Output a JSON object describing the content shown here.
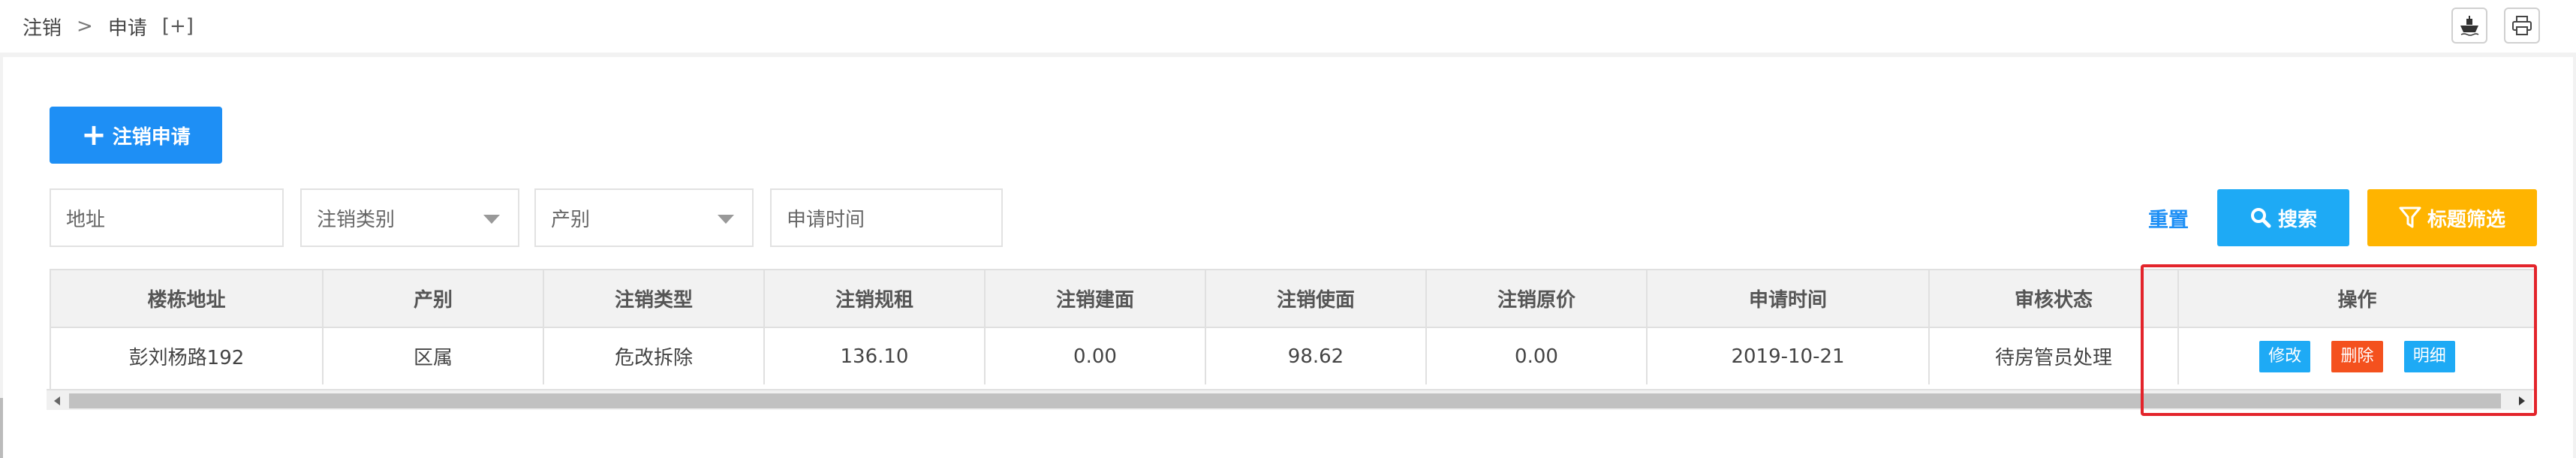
{
  "breadcrumb": {
    "root": "注销",
    "separator": ">",
    "current": "申请",
    "extra": "[+]"
  },
  "toolbar": {
    "icons": [
      "ship-icon",
      "print-icon"
    ]
  },
  "actions": {
    "add_label": "注销申请",
    "reset_label": "重置",
    "search_label": "搜索",
    "title_filter_label": "标题筛选"
  },
  "filters": {
    "address_placeholder": "地址",
    "type_placeholder": "注销类别",
    "ownership_placeholder": "产别",
    "date_placeholder": "申请时间"
  },
  "table": {
    "headers": [
      "楼栋地址",
      "产别",
      "注销类型",
      "注销规租",
      "注销建面",
      "注销使面",
      "注销原价",
      "申请时间",
      "审核状态",
      "操作"
    ],
    "rows": [
      {
        "address": "彭刘杨路192",
        "ownership": "区属",
        "type": "危改拆除",
        "rent": "136.10",
        "build_area": "0.00",
        "use_area": "98.62",
        "original_price": "0.00",
        "date": "2019-10-21",
        "status": "待房管员处理",
        "ops": {
          "edit": "修改",
          "delete": "删除",
          "detail": "明细"
        }
      }
    ]
  },
  "colors": {
    "primary": "#1e8ff5",
    "search": "#1eaaf5",
    "filter": "#ffb400",
    "delete": "#f4511e",
    "highlight": "#e3242b"
  }
}
